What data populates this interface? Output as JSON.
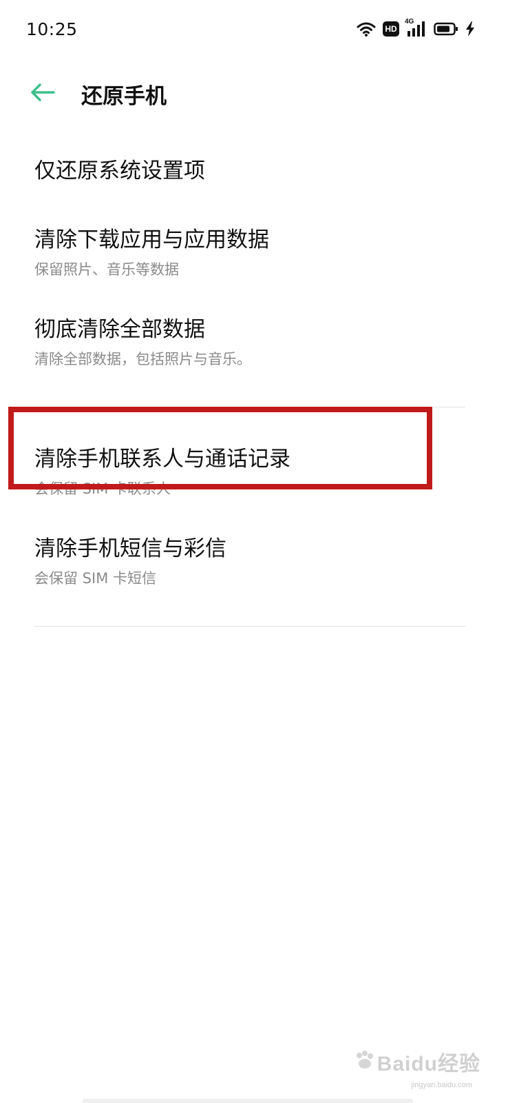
{
  "status_bar": {
    "time": "10:25",
    "hd_label": "HD",
    "network_label": "4G",
    "icons": [
      "wifi-icon",
      "hd-icon",
      "signal-4g-icon",
      "battery-icon",
      "charging-icon"
    ]
  },
  "app_bar": {
    "back_icon": "arrow-left-icon",
    "title": "还原手机",
    "accent_color": "#3dbf8a"
  },
  "items": [
    {
      "title": "仅还原系统设置项",
      "subtitle": ""
    },
    {
      "title": "清除下载应用与应用数据",
      "subtitle": "保留照片、音乐等数据"
    },
    {
      "title": "彻底清除全部数据",
      "subtitle": "清除全部数据，包括照片与音乐。"
    },
    {
      "title": "清除手机联系人与通话记录",
      "subtitle": "会保留 SIM 卡联系人"
    },
    {
      "title": "清除手机短信与彩信",
      "subtitle": "会保留 SIM 卡短信"
    }
  ],
  "highlight": {
    "color": "#c11a1a",
    "target": "清除手机联系人与通话记录"
  },
  "watermark": {
    "text": "Baidu经验",
    "sub": "jingyan.baidu.com"
  }
}
